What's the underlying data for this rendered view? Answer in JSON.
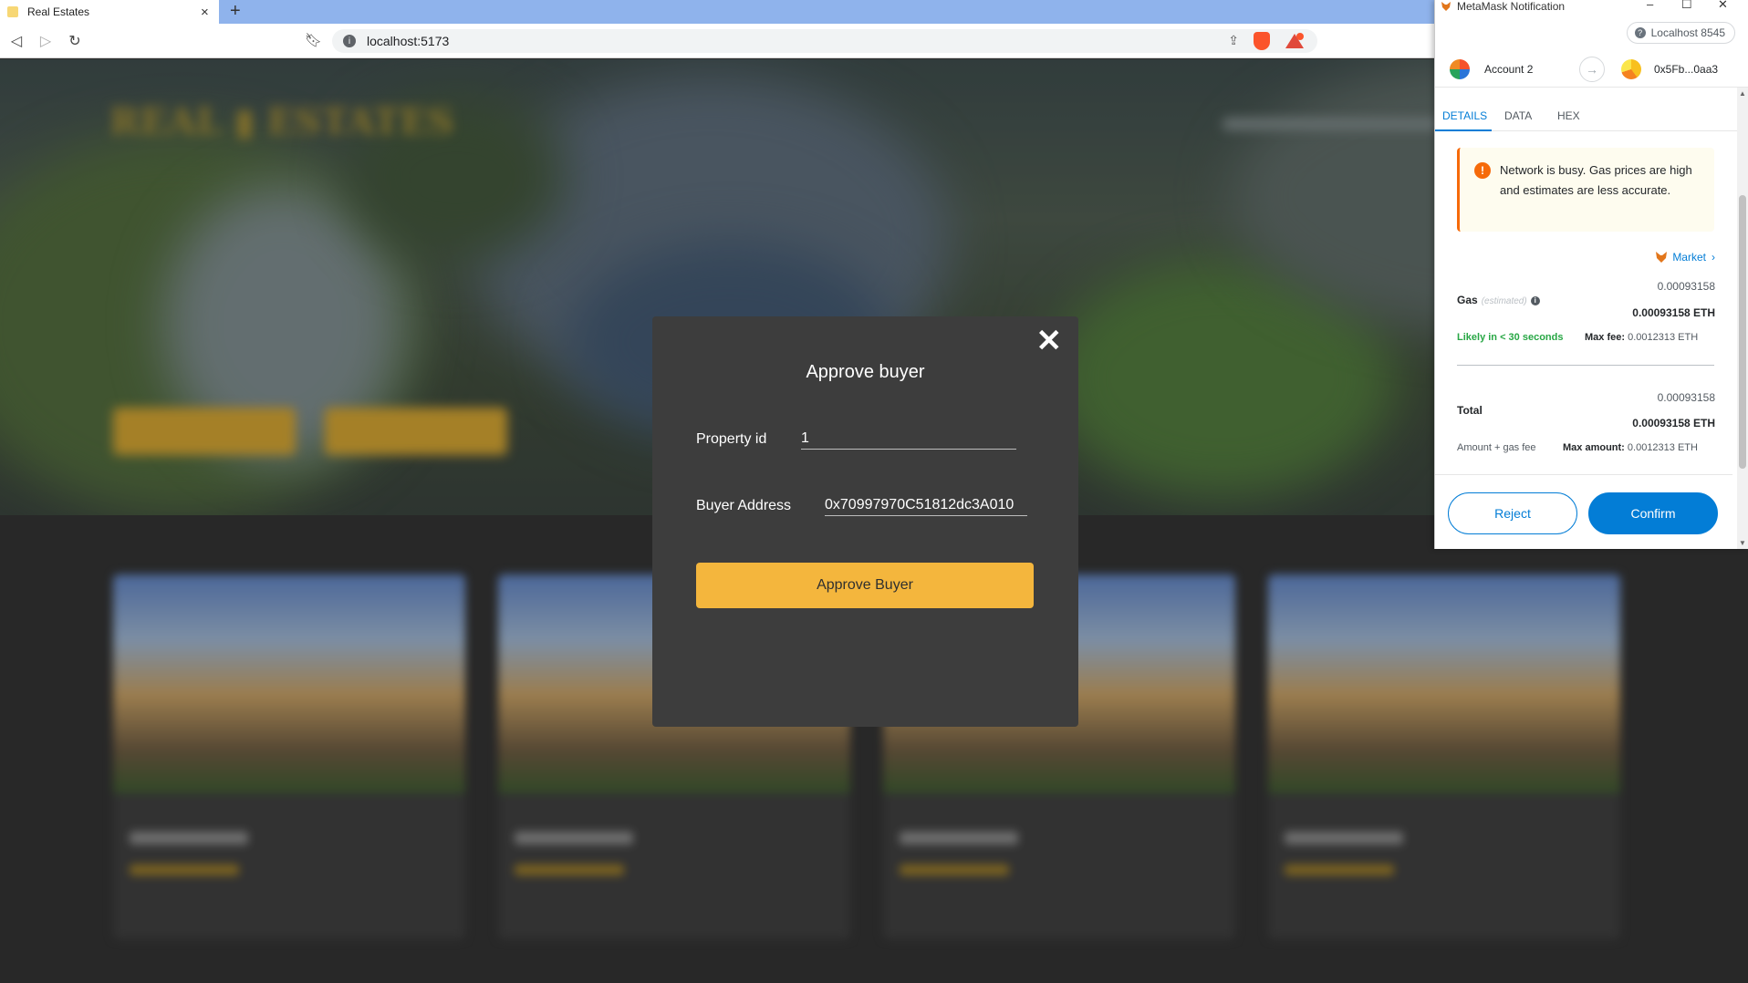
{
  "browser": {
    "tab_title": "Real Estates",
    "tab_close": "×",
    "new_tab": "+",
    "url": "localhost:5173",
    "nav": {
      "back": "◁",
      "forward": "▷",
      "reload": "↻"
    }
  },
  "modal": {
    "close_glyph": "✕",
    "title": "Approve buyer",
    "property_label": "Property id",
    "property_value": "1",
    "buyer_label": "Buyer Address",
    "buyer_value": "0x70997970C51812dc3A010",
    "submit_label": "Approve Buyer"
  },
  "metamask": {
    "window_title": "MetaMask Notification",
    "window_controls": {
      "minimize": "–",
      "maximize": "☐",
      "close": "✕"
    },
    "network": "Localhost 8545",
    "from_account": "Account 2",
    "to_address": "0x5Fb...0aa3",
    "tabs": [
      "DETAILS",
      "DATA",
      "HEX"
    ],
    "warning": "Network is busy. Gas prices are high and estimates are less accurate.",
    "market_label": "Market",
    "gas": {
      "label": "Gas",
      "estimated_label": "(estimated)",
      "secondary_value": "0.00093158",
      "primary_value": "0.00093158 ETH",
      "likely_label": "Likely in < 30 seconds",
      "max_fee_label": "Max fee:",
      "max_fee_value": "0.0012313 ETH"
    },
    "total": {
      "label": "Total",
      "secondary_value": "0.00093158",
      "primary_value": "0.00093158 ETH",
      "sub_label": "Amount + gas fee",
      "max_amount_label": "Max amount:",
      "max_amount_value": "0.0012313 ETH"
    },
    "reject_label": "Reject",
    "confirm_label": "Confirm",
    "colors": {
      "primary": "#037dd6",
      "warning": "#f66a0a",
      "success": "#28a745"
    }
  },
  "colors": {
    "accent": "#f4b63d",
    "modal_bg": "#3d3d3d"
  }
}
